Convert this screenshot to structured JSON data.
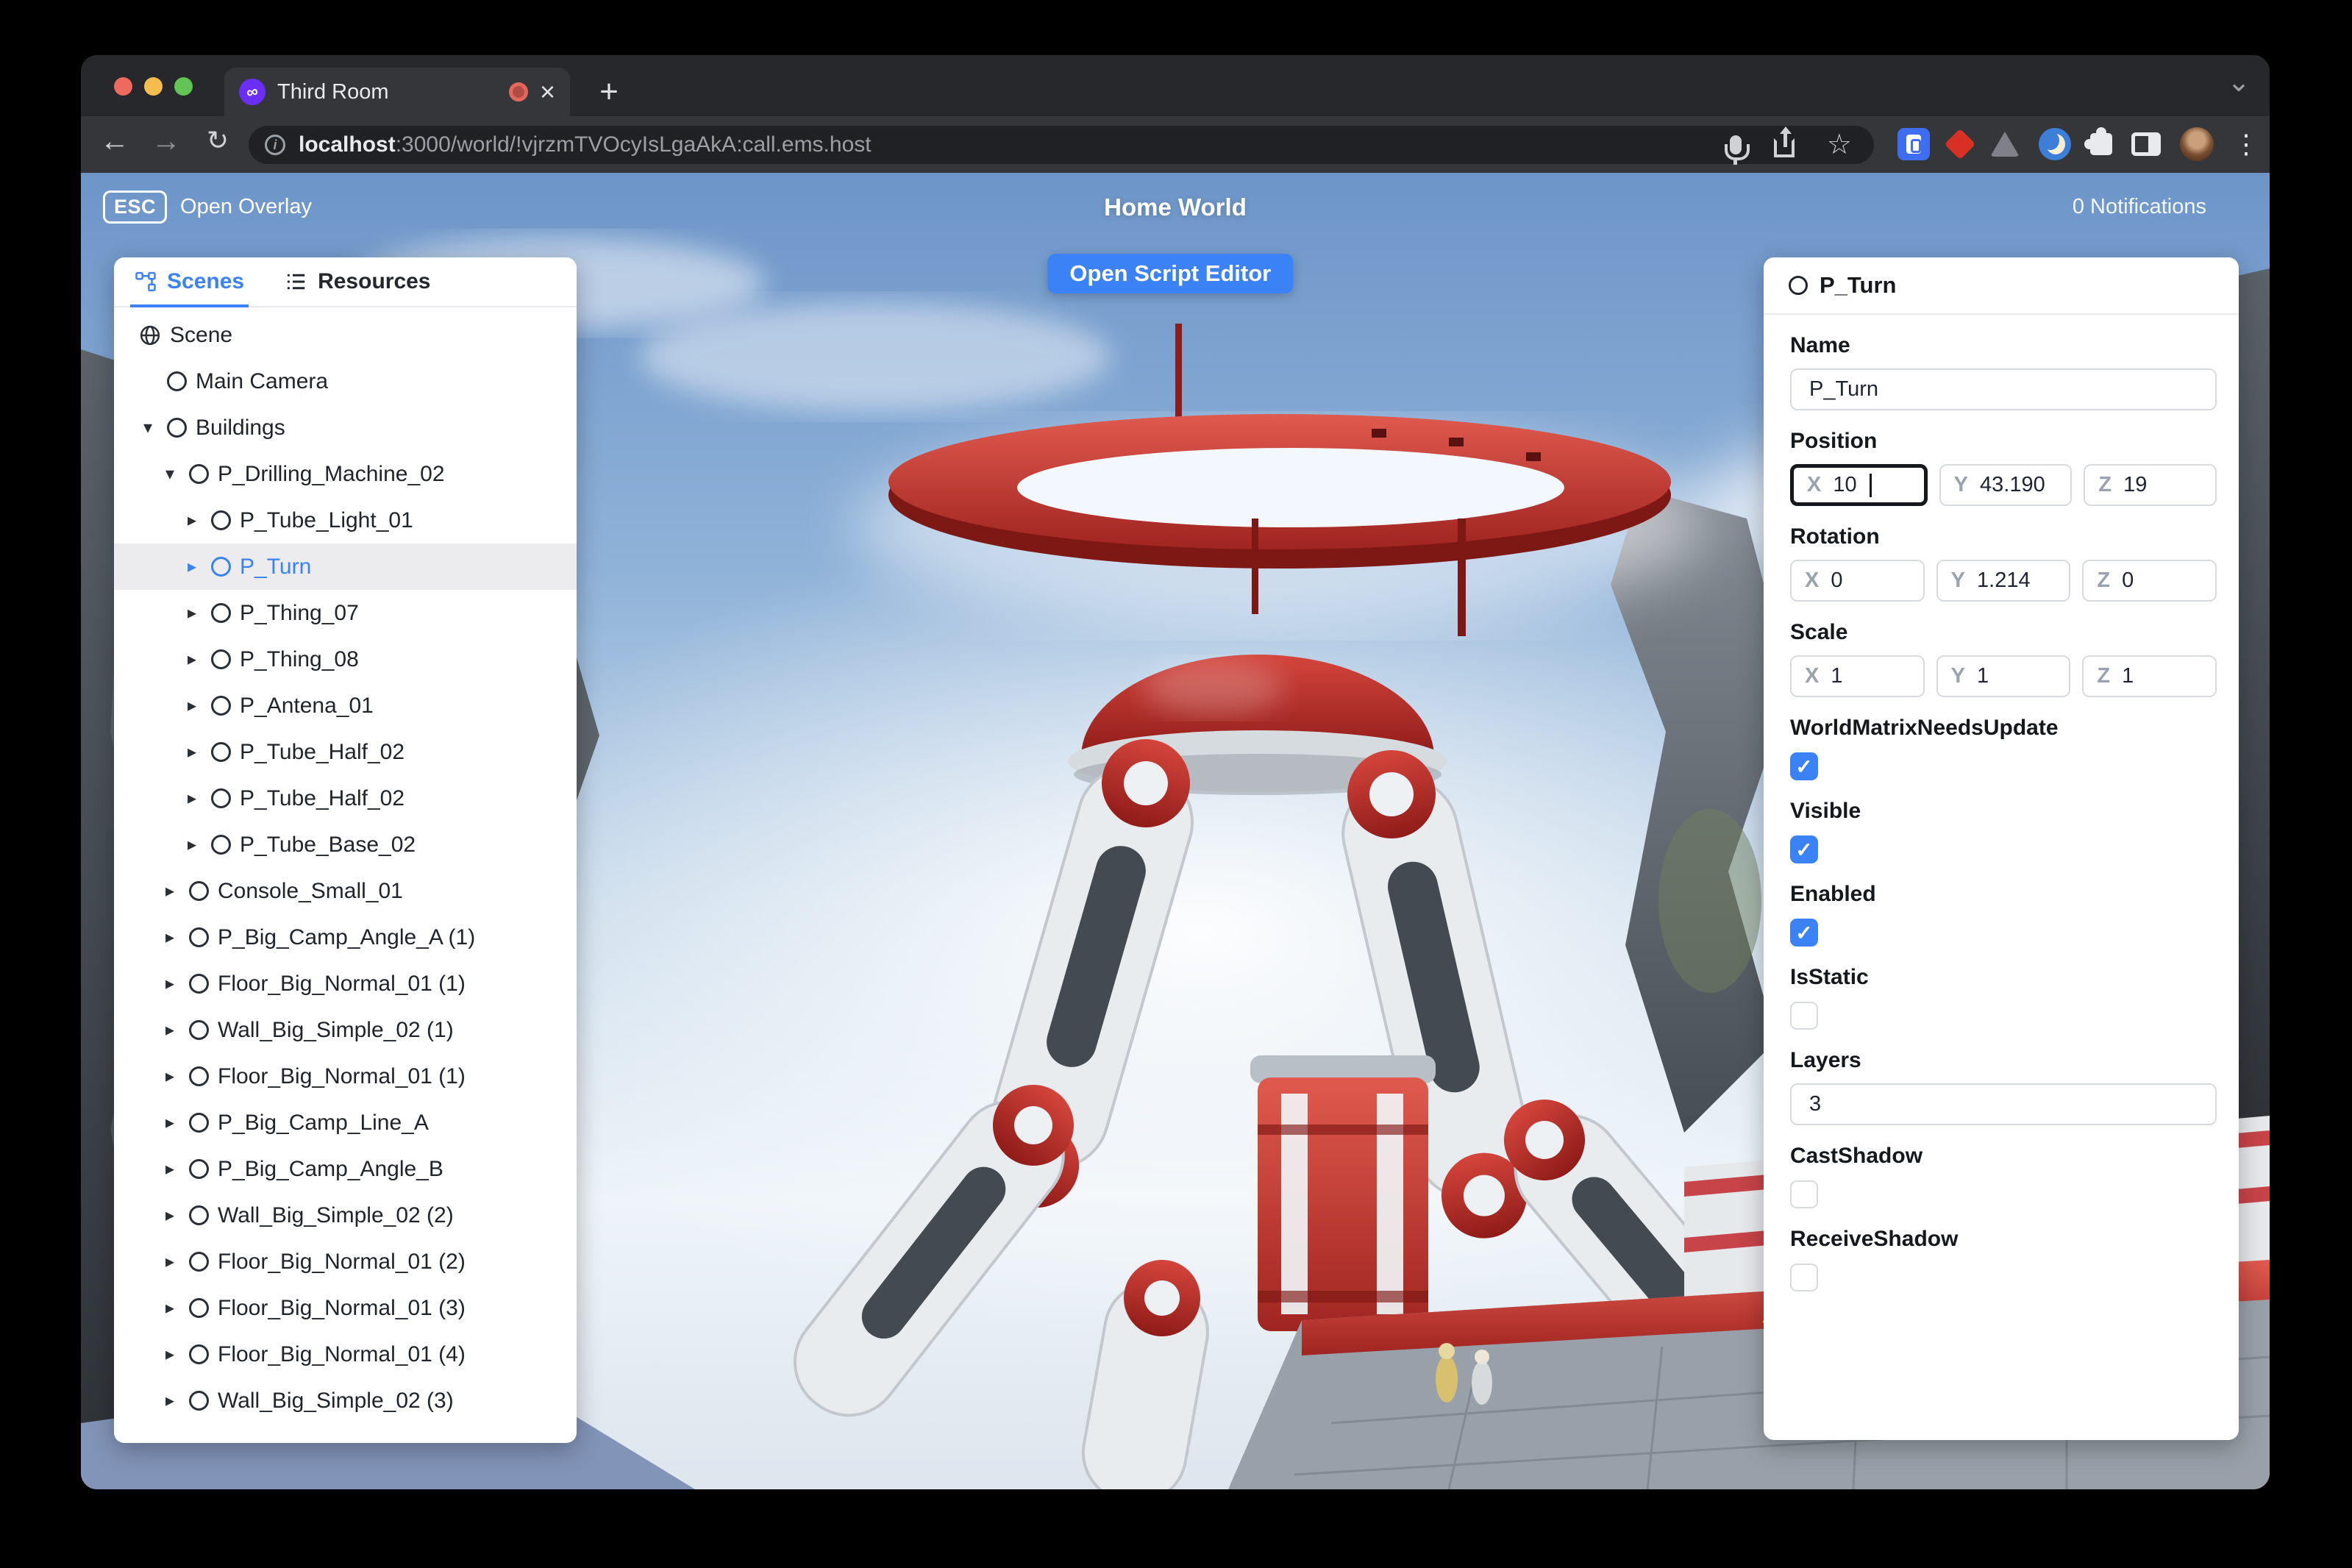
{
  "browser": {
    "tab_title": "Third Room",
    "url_host": "localhost",
    "url_rest": ":3000/world/!vjrzmTVOcyIsLgaAkA:call.ems.host"
  },
  "icons": {
    "back": "←",
    "forward": "→",
    "reload": "↻",
    "star": "☆",
    "menu": "⋮",
    "new_tab": "+",
    "window_chevron": "⌄",
    "close_tab": "×",
    "info": "i",
    "tree_expanded": "▾",
    "tree_collapsed": "▸",
    "check": "✓",
    "favicon_glyph": "∞"
  },
  "overlay": {
    "esc_key": "ESC",
    "esc_label": "Open Overlay",
    "world_title": "Home World",
    "notifications": "0 Notifications",
    "open_script_editor": "Open Script Editor"
  },
  "left_panel": {
    "tabs": [
      {
        "label": "Scenes"
      },
      {
        "label": "Resources"
      }
    ],
    "tree": [
      {
        "label": "Scene",
        "level": 0,
        "icon": "globe",
        "arrow": "none",
        "selected": false
      },
      {
        "label": "Main Camera",
        "level": 1,
        "icon": "node",
        "arrow": "none",
        "selected": false
      },
      {
        "label": "Buildings",
        "level": 1,
        "icon": "node",
        "arrow": "expanded",
        "selected": false
      },
      {
        "label": "P_Drilling_Machine_02",
        "level": 2,
        "icon": "node",
        "arrow": "expanded",
        "selected": false
      },
      {
        "label": "P_Tube_Light_01",
        "level": 3,
        "icon": "node",
        "arrow": "collapsed",
        "selected": false
      },
      {
        "label": "P_Turn",
        "level": 3,
        "icon": "node",
        "arrow": "collapsed",
        "selected": true
      },
      {
        "label": "P_Thing_07",
        "level": 3,
        "icon": "node",
        "arrow": "collapsed",
        "selected": false
      },
      {
        "label": "P_Thing_08",
        "level": 3,
        "icon": "node",
        "arrow": "collapsed",
        "selected": false
      },
      {
        "label": "P_Antena_01",
        "level": 3,
        "icon": "node",
        "arrow": "collapsed",
        "selected": false
      },
      {
        "label": "P_Tube_Half_02",
        "level": 3,
        "icon": "node",
        "arrow": "collapsed",
        "selected": false
      },
      {
        "label": "P_Tube_Half_02",
        "level": 3,
        "icon": "node",
        "arrow": "collapsed",
        "selected": false
      },
      {
        "label": "P_Tube_Base_02",
        "level": 3,
        "icon": "node",
        "arrow": "collapsed",
        "selected": false
      },
      {
        "label": "Console_Small_01",
        "level": 2,
        "icon": "node",
        "arrow": "collapsed",
        "selected": false
      },
      {
        "label": "P_Big_Camp_Angle_A (1)",
        "level": 2,
        "icon": "node",
        "arrow": "collapsed",
        "selected": false
      },
      {
        "label": "Floor_Big_Normal_01 (1)",
        "level": 2,
        "icon": "node",
        "arrow": "collapsed",
        "selected": false
      },
      {
        "label": "Wall_Big_Simple_02 (1)",
        "level": 2,
        "icon": "node",
        "arrow": "collapsed",
        "selected": false
      },
      {
        "label": "Floor_Big_Normal_01 (1)",
        "level": 2,
        "icon": "node",
        "arrow": "collapsed",
        "selected": false
      },
      {
        "label": "P_Big_Camp_Line_A",
        "level": 2,
        "icon": "node",
        "arrow": "collapsed",
        "selected": false
      },
      {
        "label": "P_Big_Camp_Angle_B",
        "level": 2,
        "icon": "node",
        "arrow": "collapsed",
        "selected": false
      },
      {
        "label": "Wall_Big_Simple_02 (2)",
        "level": 2,
        "icon": "node",
        "arrow": "collapsed",
        "selected": false
      },
      {
        "label": "Floor_Big_Normal_01 (2)",
        "level": 2,
        "icon": "node",
        "arrow": "collapsed",
        "selected": false
      },
      {
        "label": "Floor_Big_Normal_01 (3)",
        "level": 2,
        "icon": "node",
        "arrow": "collapsed",
        "selected": false
      },
      {
        "label": "Floor_Big_Normal_01 (4)",
        "level": 2,
        "icon": "node",
        "arrow": "collapsed",
        "selected": false
      },
      {
        "label": "Wall_Big_Simple_02 (3)",
        "level": 2,
        "icon": "node",
        "arrow": "collapsed",
        "selected": false
      }
    ]
  },
  "right_panel": {
    "title": "P_Turn",
    "axis": {
      "x": "X",
      "y": "Y",
      "z": "Z"
    },
    "name": {
      "label": "Name",
      "value": "P_Turn"
    },
    "position": {
      "label": "Position",
      "x": "10",
      "y": "43.190",
      "z": "19"
    },
    "rotation": {
      "label": "Rotation",
      "x": "0",
      "y": "1.214",
      "z": "0"
    },
    "scale": {
      "label": "Scale",
      "x": "1",
      "y": "1",
      "z": "1"
    },
    "world_matrix": {
      "label": "WorldMatrixNeedsUpdate",
      "checked": true
    },
    "visible": {
      "label": "Visible",
      "checked": true
    },
    "enabled": {
      "label": "Enabled",
      "checked": true
    },
    "is_static": {
      "label": "IsStatic",
      "checked": false
    },
    "layers": {
      "label": "Layers",
      "value": "3"
    },
    "cast_shadow": {
      "label": "CastShadow",
      "checked": false
    },
    "receive_shadow": {
      "label": "ReceiveShadow",
      "checked": false
    }
  },
  "colors": {
    "accent_blue": "#3b82f6",
    "selection_gray": "#ececee",
    "machine_red": "#c1272d",
    "toolbar_dark": "#35363a"
  }
}
